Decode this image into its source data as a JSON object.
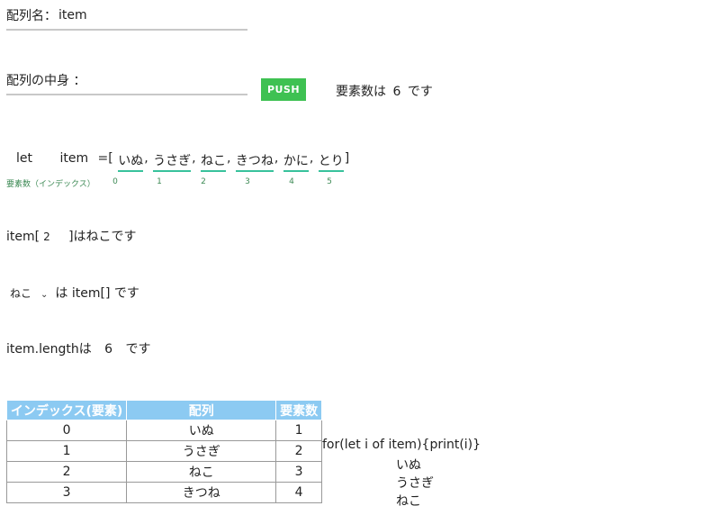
{
  "array_name_label": "配列名：",
  "array_name_value": "item",
  "contents_label": "配列の中身 ：",
  "contents_value": "",
  "push_label": "PUSH",
  "count_prefix": "要素数は",
  "count_value": "6",
  "count_suffix": "です",
  "decl_let": "let",
  "decl_name": "item",
  "decl_eq": "=[",
  "decl_close": "]",
  "decl_comma": ",",
  "items": [
    "いぬ",
    "うさぎ",
    "ねこ",
    "きつね",
    "かに",
    "とり"
  ],
  "index_caption": "要素数（インデックス）",
  "indices": [
    "0",
    "1",
    "2",
    "3",
    "4",
    "5"
  ],
  "access_prefix": "item[",
  "access_index": "2",
  "access_suffix": "]はねこです",
  "select_value": "ねこ",
  "select_suffix": "は item[] です",
  "length_prefix": "item.lengthは",
  "length_value": "6",
  "length_suffix": "です",
  "table": {
    "headers": [
      "インデックス(要素)",
      "配列",
      "要素数"
    ],
    "rows": [
      [
        "0",
        "いぬ",
        "1"
      ],
      [
        "1",
        "うさぎ",
        "2"
      ],
      [
        "2",
        "ねこ",
        "3"
      ],
      [
        "3",
        "きつね",
        "4"
      ]
    ]
  },
  "loop_code": "for(let i of item){print(i)}",
  "loop_output": [
    "いぬ",
    "うさぎ",
    "ねこ"
  ],
  "colors": {
    "push": "#3ec152",
    "underline": "#38c29c",
    "table_header": "#8ccaf2"
  }
}
